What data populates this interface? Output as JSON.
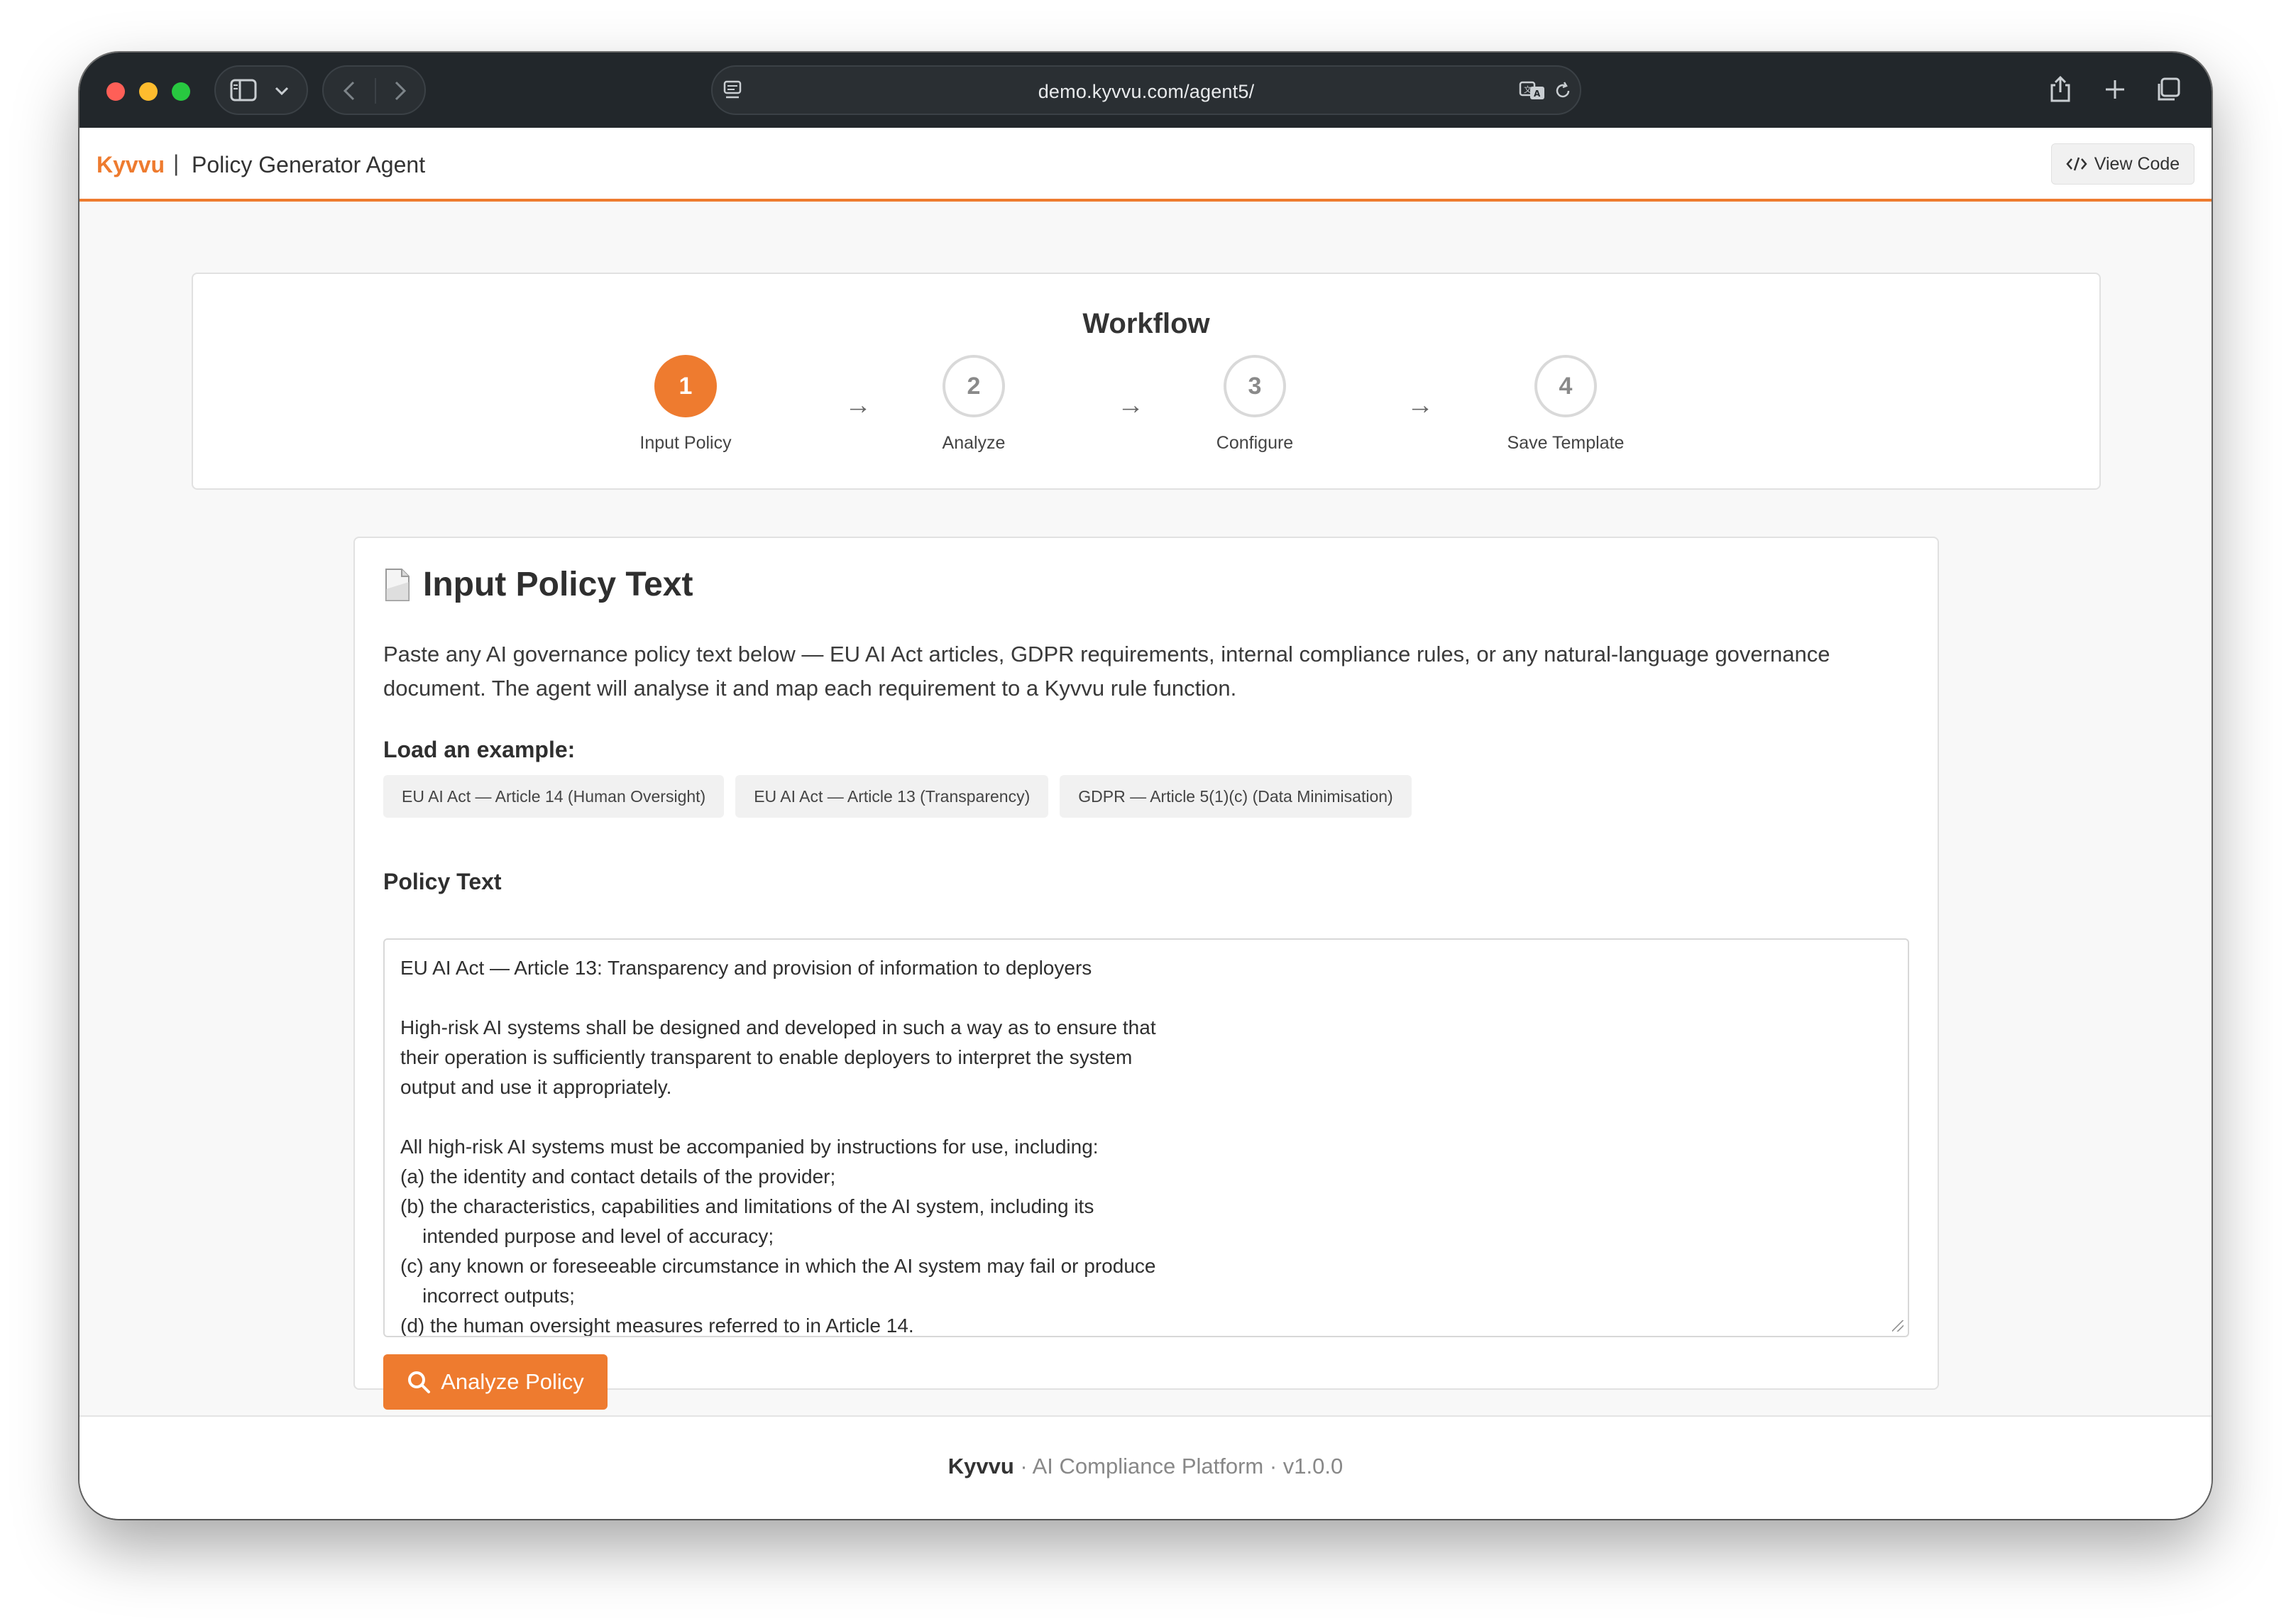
{
  "browser": {
    "url": "demo.kyvvu.com/agent5/"
  },
  "header": {
    "brand": "Kyvvu",
    "separator": "|",
    "title": "Policy Generator Agent",
    "view_code_label": "View Code"
  },
  "workflow": {
    "title": "Workflow",
    "steps": [
      {
        "number": "1",
        "label": "Input Policy",
        "active": true
      },
      {
        "number": "2",
        "label": "Analyze",
        "active": false
      },
      {
        "number": "3",
        "label": "Configure",
        "active": false
      },
      {
        "number": "4",
        "label": "Save Template",
        "active": false
      }
    ],
    "arrow": "→"
  },
  "card": {
    "title": "Input Policy Text",
    "intro": "Paste any AI governance policy text below — EU AI Act articles, GDPR requirements, internal compliance rules, or any natural-language governance document. The agent will analyse it and map each requirement to a Kyvvu rule function.",
    "load_label": "Load an example:",
    "examples": [
      "EU AI Act — Article 14 (Human Oversight)",
      "EU AI Act — Article 13 (Transparency)",
      "GDPR — Article 5(1)(c) (Data Minimisation)"
    ],
    "policy_label": "Policy Text",
    "policy_lines": [
      "EU AI Act — Article 13: Transparency and provision of information to deployers",
      "",
      "High-risk AI systems shall be designed and developed in such a way as to ensure that",
      "their operation is sufficiently transparent to enable deployers to interpret the system",
      "output and use it appropriately.",
      "",
      "All high-risk AI systems must be accompanied by instructions for use, including:",
      "(a) the identity and contact details of the provider;",
      "(b) the characteristics, capabilities and limitations of the AI system, including its",
      "    intended purpose and level of accuracy;",
      "(c) any known or foreseeable circumstance in which the AI system may fail or produce",
      "    incorrect outputs;",
      "(d) the human oversight measures referred to in Article 14."
    ],
    "analyze_label": "Analyze Policy"
  },
  "footer": {
    "brand": "Kyvvu",
    "rest": " · AI Compliance Platform · v1.0.0"
  },
  "colors": {
    "accent": "#ee7b2f",
    "titlebar": "#22272b"
  }
}
